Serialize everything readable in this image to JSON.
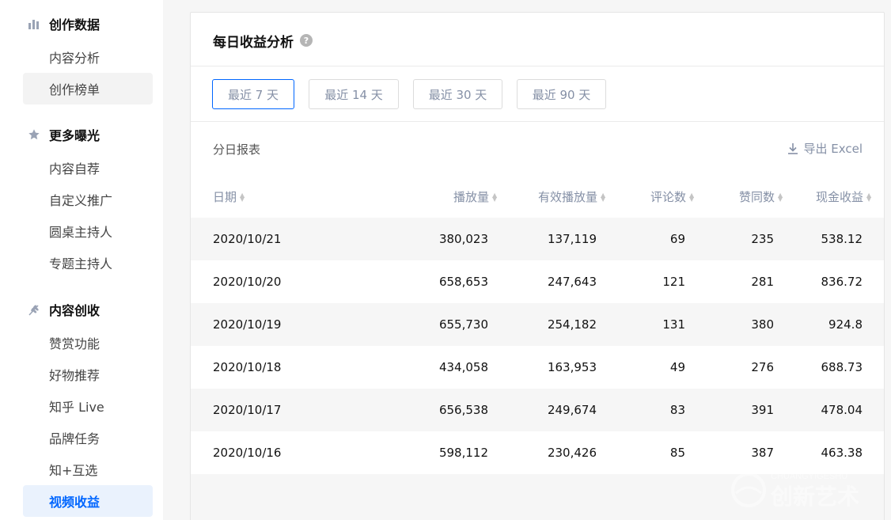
{
  "sidebar": {
    "sections": [
      {
        "title": "创作数据",
        "icon": "bar-chart-icon",
        "items": [
          {
            "label": "内容分析",
            "state": "normal"
          },
          {
            "label": "创作榜单",
            "state": "hover"
          }
        ]
      },
      {
        "title": "更多曝光",
        "icon": "star-icon",
        "items": [
          {
            "label": "内容自荐",
            "state": "normal"
          },
          {
            "label": "自定义推广",
            "state": "normal"
          },
          {
            "label": "圆桌主持人",
            "state": "normal"
          },
          {
            "label": "专题主持人",
            "state": "normal"
          }
        ]
      },
      {
        "title": "内容创收",
        "icon": "wheat-icon",
        "items": [
          {
            "label": "赞赏功能",
            "state": "normal"
          },
          {
            "label": "好物推荐",
            "state": "normal"
          },
          {
            "label": "知乎 Live",
            "state": "normal"
          },
          {
            "label": "品牌任务",
            "state": "normal"
          },
          {
            "label": "知+互选",
            "state": "normal"
          },
          {
            "label": "视频收益",
            "state": "active"
          }
        ]
      }
    ]
  },
  "main": {
    "title": "每日收益分析",
    "help_icon": "?",
    "ranges": [
      {
        "label": "最近 7 天",
        "selected": true
      },
      {
        "label": "最近 14 天",
        "selected": false
      },
      {
        "label": "最近 30 天",
        "selected": false
      },
      {
        "label": "最近 90 天",
        "selected": false
      }
    ],
    "report_title": "分日报表",
    "export_label": "导出 Excel",
    "columns": [
      "日期",
      "播放量",
      "有效播放量",
      "评论数",
      "赞同数",
      "现金收益"
    ],
    "rows": [
      [
        "2020/10/21",
        "380,023",
        "137,119",
        "69",
        "235",
        "538.12"
      ],
      [
        "2020/10/20",
        "658,653",
        "247,643",
        "121",
        "281",
        "836.72"
      ],
      [
        "2020/10/19",
        "655,730",
        "254,182",
        "131",
        "380",
        "924.8"
      ],
      [
        "2020/10/18",
        "434,058",
        "163,953",
        "49",
        "276",
        "688.73"
      ],
      [
        "2020/10/17",
        "656,538",
        "249,674",
        "83",
        "391",
        "478.04"
      ],
      [
        "2020/10/16",
        "598,112",
        "230,426",
        "85",
        "387",
        "463.38"
      ]
    ]
  },
  "colors": {
    "accent": "#0066ff",
    "active_bg": "#eaf2fd",
    "muted_text": "#8590a6",
    "row_shade": "#f6f6f6"
  },
  "watermark": {
    "text_top": "CHUANGYIGESHU",
    "text_main": "创新艺术"
  }
}
